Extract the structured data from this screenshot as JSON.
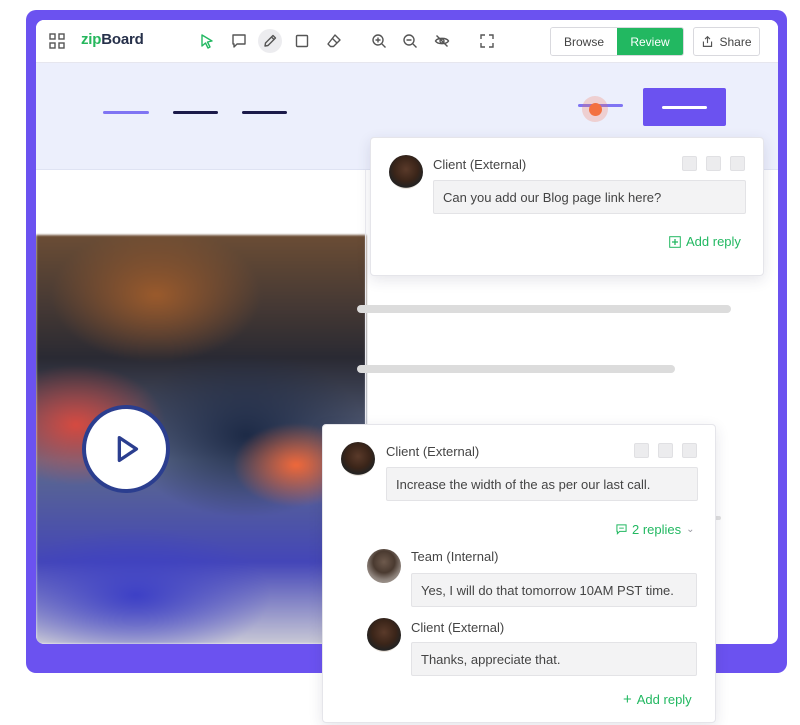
{
  "app": {
    "logo_part1": "zip",
    "logo_part2": "Board"
  },
  "toolbar": {
    "browse_label": "Browse",
    "review_label": "Review",
    "share_label": "Share"
  },
  "comments": [
    {
      "author": "Client (External)",
      "text": "Can you add our Blog page link here?",
      "action_label": "Add reply"
    },
    {
      "author": "Client (External)",
      "text": "Increase the width of the as per our last call.",
      "replies_label": "2 replies",
      "replies": [
        {
          "author": "Team (Internal)",
          "text": "Yes, I will do that tomorrow 10AM PST time."
        },
        {
          "author": "Client (External)",
          "text": "Thanks, appreciate that."
        }
      ],
      "action_label": "Add reply"
    }
  ],
  "colors": {
    "frame": "#6b52f0",
    "accent_green": "#22b861",
    "hero_bg": "#eceffc",
    "pin": "#f3703f"
  }
}
